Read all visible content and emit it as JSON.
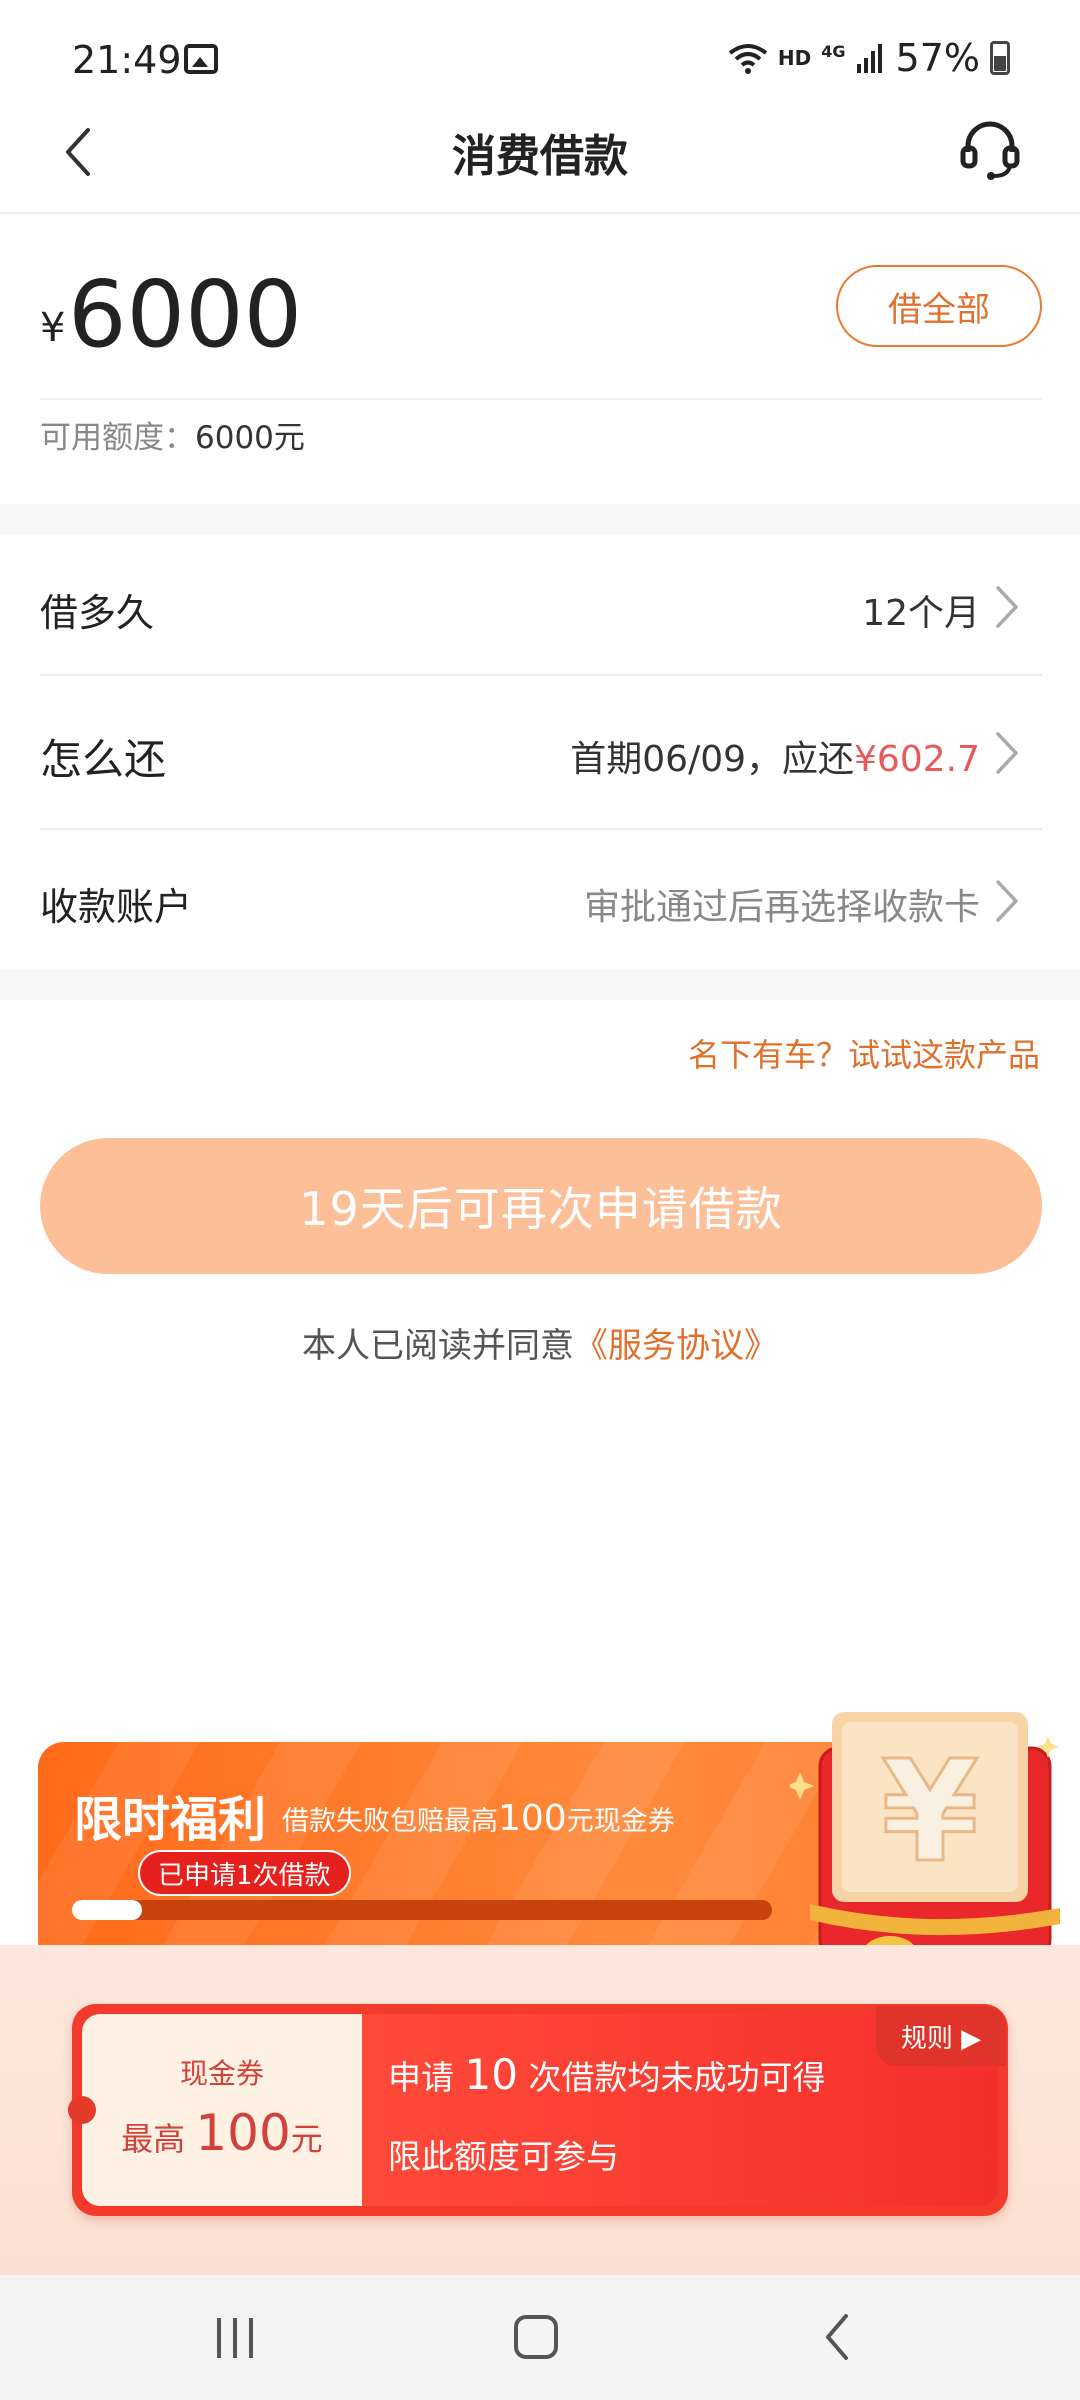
{
  "status_bar": {
    "time": "21:49",
    "network": "HD",
    "network_gen": "4G",
    "battery": "57%",
    "icons": [
      "image-icon",
      "wifi-icon",
      "signal-icon",
      "battery-icon"
    ]
  },
  "header": {
    "title": "消费借款",
    "back_icon": "chevron-left-icon",
    "support_icon": "headset-icon"
  },
  "amount_section": {
    "currency": "¥",
    "amount": "6000",
    "borrow_all_label": "借全部",
    "credit_label": "可用额度：",
    "credit_value": "6000元"
  },
  "rows": [
    {
      "label": "借多久",
      "value": "12个月"
    },
    {
      "label": "怎么还",
      "value_prefix": "首期06/09，应还",
      "value_highlight": "¥602.7"
    },
    {
      "label": "收款账户",
      "value": "审批通过后再选择收款卡"
    }
  ],
  "car_link": "名下有车？试试这款产品",
  "apply_button": "19天后可再次申请借款",
  "agreement": {
    "prefix": "本人已阅读并同意",
    "link": "《服务协议》"
  },
  "promo": {
    "title": "限时福利",
    "subtitle_prefix": "借款失败包赔最高",
    "subtitle_amount": "100",
    "subtitle_suffix": "元现金券",
    "applied_badge": "已申请1次借款",
    "progress": 0.1
  },
  "coupon": {
    "left_label": "现金券",
    "left_prefix": "最高",
    "left_amount": "100",
    "left_unit": "元",
    "line1_prefix": "申请",
    "line1_count": "10",
    "line1_suffix": "次借款均未成功可得",
    "line2": "限此额度可参与",
    "rules_label": "规则 ▶",
    "redpacket_symbol": "¥"
  },
  "colors": {
    "accent": "#e0702c",
    "apply_button_bg": "#fdbf98",
    "highlight_red": "#e85a5a",
    "promo_orange": "#ff6a1a",
    "coupon_red": "#f23b2c"
  }
}
